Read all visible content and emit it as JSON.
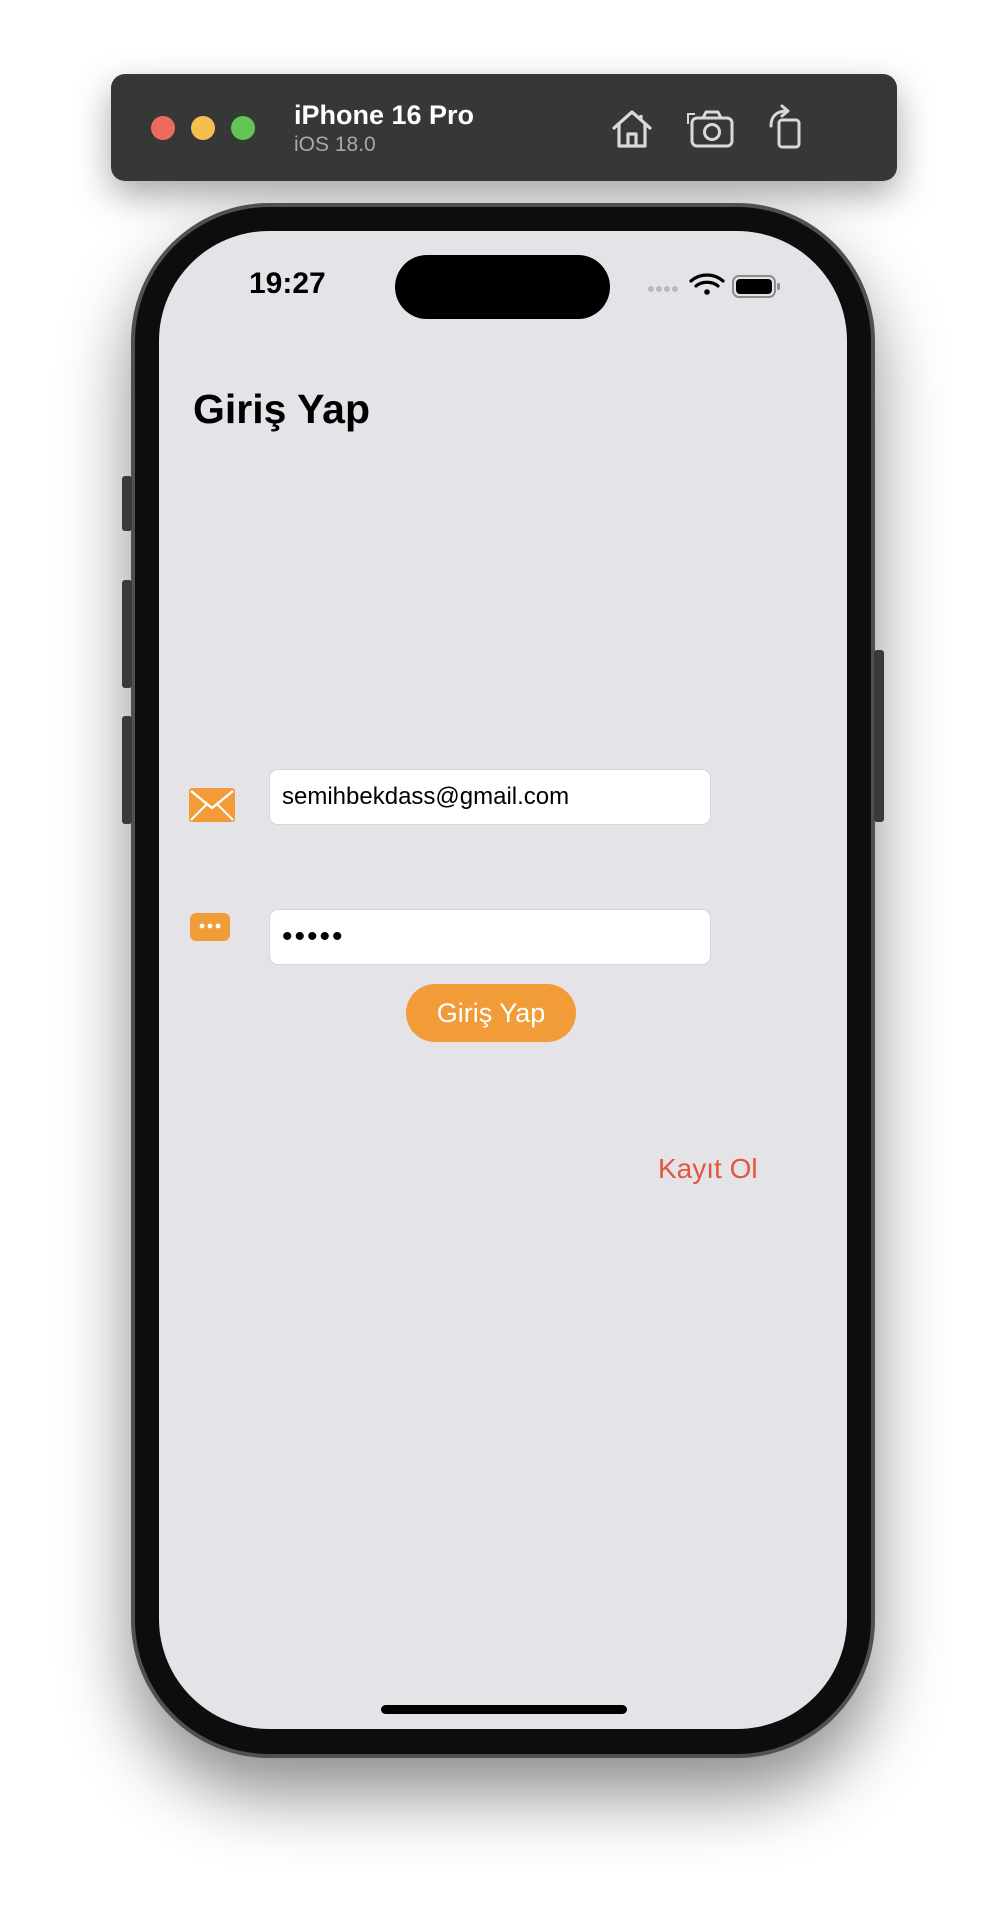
{
  "simulator": {
    "device_name": "iPhone 16 Pro",
    "os_version": "iOS 18.0",
    "toolbar_icons": [
      "home-icon",
      "screenshot-icon",
      "rotate-icon"
    ]
  },
  "status_bar": {
    "time": "19:27",
    "icons": [
      "cellular-icon",
      "wifi-icon",
      "battery-icon"
    ]
  },
  "screen": {
    "title": "Giriş Yap",
    "email_field": {
      "value": "semihbekdass@gmail.com",
      "icon": "envelope-icon"
    },
    "password_field": {
      "value": "•••••",
      "icon": "password-dots-icon"
    },
    "login_button": "Giriş Yap",
    "register_link": "Kayıt Ol"
  },
  "colors": {
    "accent": "#f19c39",
    "link": "#e5553f",
    "background": "#e4e3e8"
  }
}
